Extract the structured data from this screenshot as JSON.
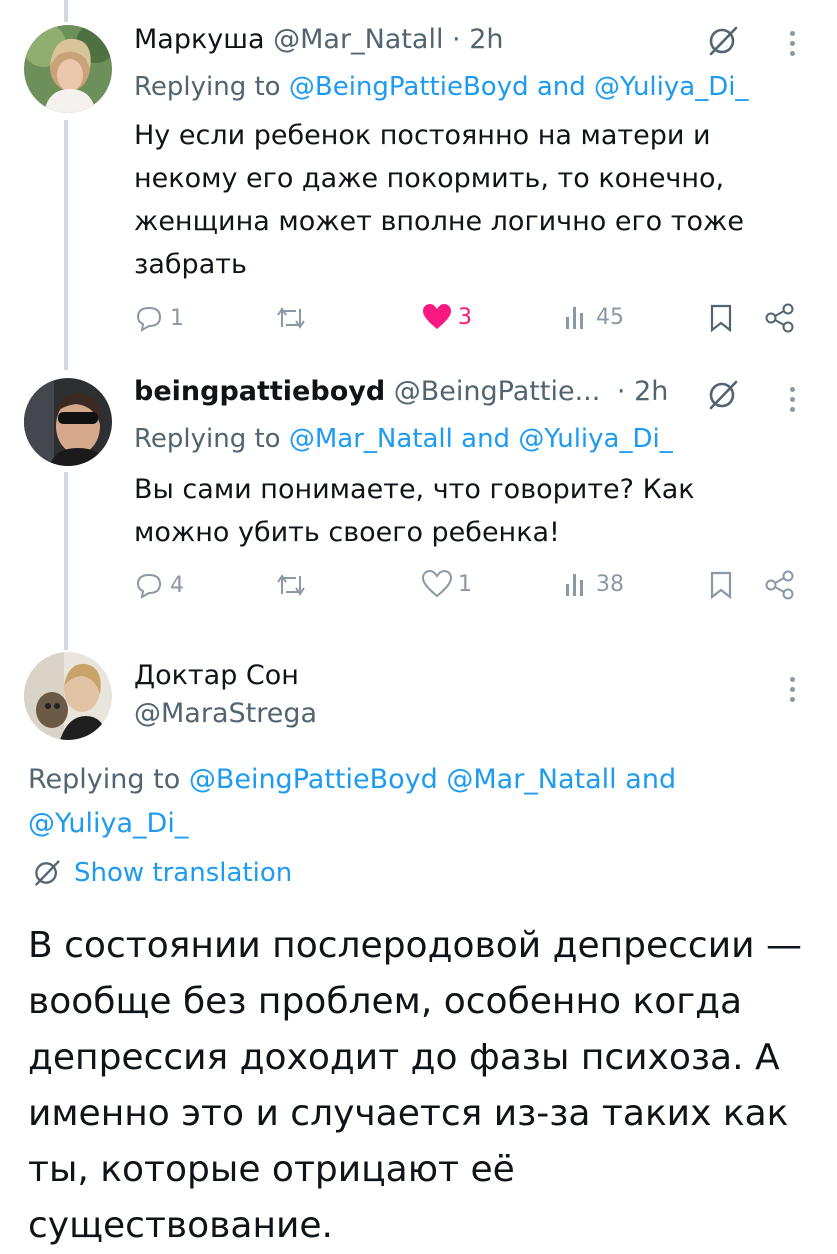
{
  "tweets": [
    {
      "name": "Маркуша",
      "handle": "@Mar_Natall",
      "separator": "·",
      "time": "2h",
      "replying_prefix": "Replying to",
      "mention1": "@BeingPattieBoyd",
      "and": "and",
      "mention2": "@Yuliya_Di_",
      "text": "Ну если ребенок постоянно на матери и некому его даже покормить, то конечно, женщина может вполне логично его тоже забрать",
      "replies": "1",
      "reposts": "",
      "likes": "3",
      "views": "45",
      "liked": true
    },
    {
      "name": "beingpattieboyd",
      "handle": "@BeingPattie...",
      "separator": "·",
      "time": "2h",
      "replying_prefix": "Replying to",
      "mention1": "@Mar_Natall",
      "and": "and",
      "mention2": "@Yuliya_Di_",
      "text": "Вы сами понимаете, что говорите? Как можно убить своего ребенка!",
      "replies": "4",
      "reposts": "",
      "likes": "1",
      "views": "38",
      "liked": false
    }
  ],
  "main": {
    "name": "Доктар Сон",
    "handle": "@MaraStrega",
    "replying_prefix": "Replying to",
    "mention1": "@BeingPattieBoyd",
    "mention2": "@Mar_Natall",
    "and": "and",
    "mention3": "@Yuliya_Di_",
    "show_translation": "Show translation",
    "text": "В состоянии послеродовой депрессии — вообще без проблем, особенно когда депрессия доходит до фазы психоза. А именно это и случается из-за таких как ты, которые отрицают её существование."
  },
  "colors": {
    "accent": "#1d9bf0",
    "like": "#f91880",
    "muted": "#536471",
    "thread_line": "#cfd9de"
  },
  "icons": [
    "reply-icon",
    "repost-icon",
    "like-icon",
    "views-icon",
    "bookmark-icon",
    "share-icon",
    "grok-icon",
    "more-icon",
    "translate-icon"
  ]
}
